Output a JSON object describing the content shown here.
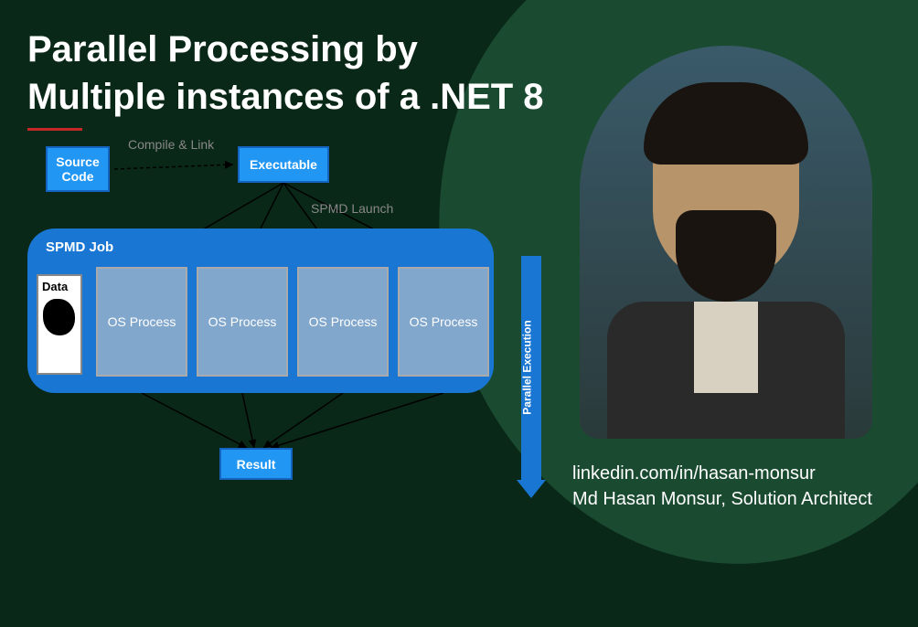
{
  "title_line1": "Parallel Processing by",
  "title_line2": "Multiple instances of a .NET 8",
  "diagram": {
    "source_code": "Source Code",
    "executable": "Executable",
    "compile_link": "Compile & Link",
    "spmd_launch": "SPMD Launch",
    "spmd_job": "SPMD Job",
    "data": "Data",
    "os_process": "OS Process",
    "result": "Result",
    "parallel_execution": "Parallel Execution"
  },
  "credits": {
    "linkedin": "linkedin.com/in/hasan-monsur",
    "name_title": "Md Hasan Monsur, Solution Architect"
  }
}
